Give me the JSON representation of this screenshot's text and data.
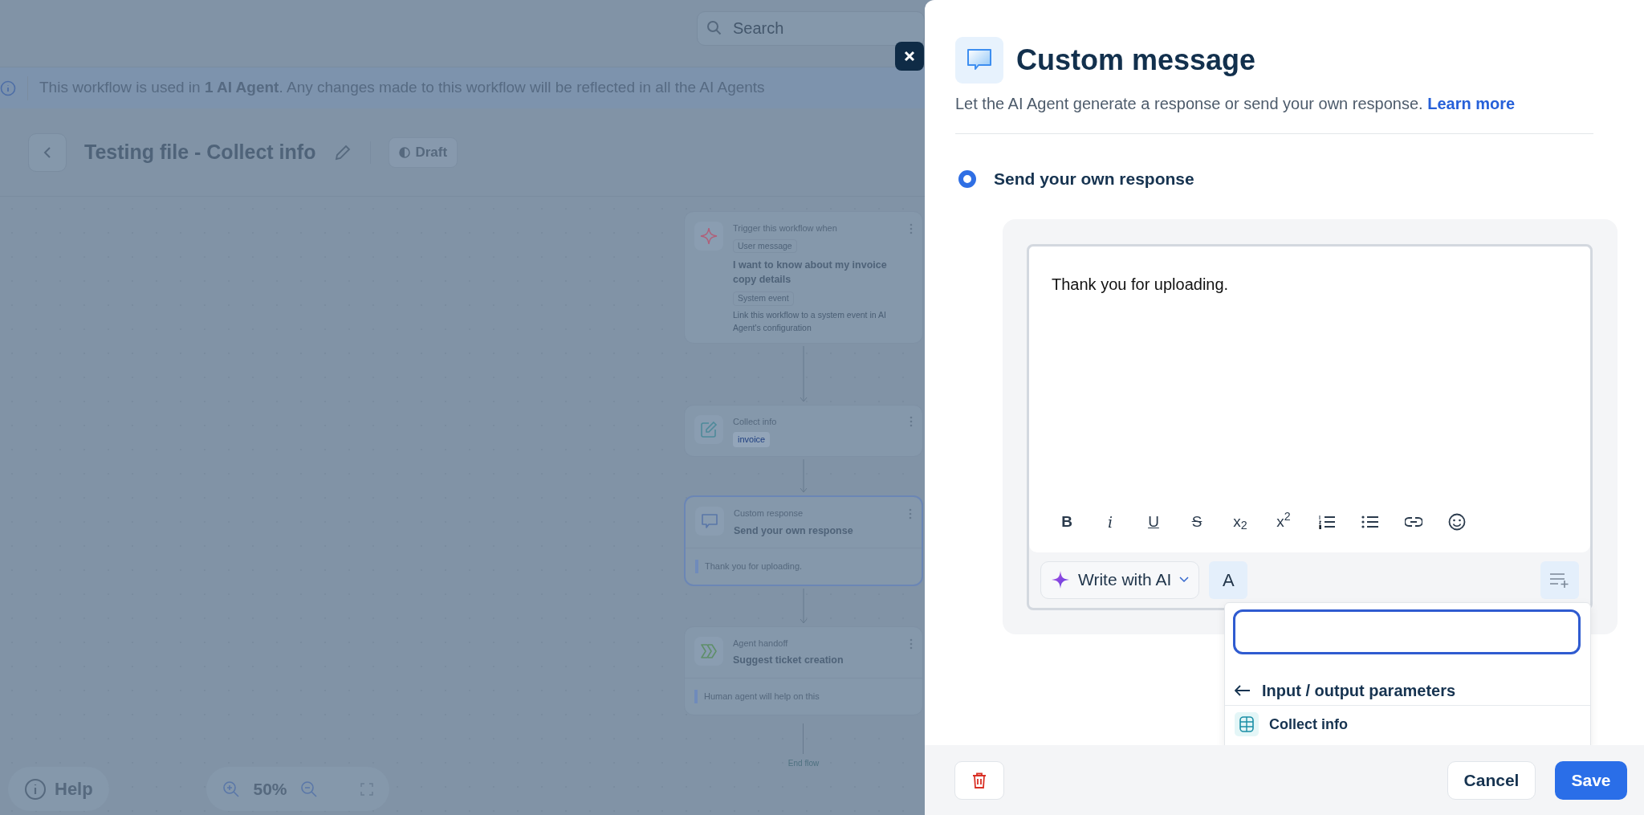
{
  "search": {
    "placeholder": "Search"
  },
  "banner": {
    "text": "This workflow is used in **1 AI Agent**. Any changes made to this workflow will be reflected in all the AI Agents"
  },
  "header": {
    "title": "Testing file - Collect info",
    "status": "Draft"
  },
  "flow": {
    "nodes": [
      {
        "kind": "trigger",
        "label": "Trigger this workflow when",
        "selected": false,
        "sections": [
          {
            "tag": "User message",
            "text": "I want to know about my invoice copy details"
          },
          {
            "tag": "System event",
            "hint": "Link this workflow to a system event in AI Agent's configuration"
          }
        ]
      },
      {
        "kind": "collect",
        "label": "Collect info",
        "selected": false,
        "chip": "invoice"
      },
      {
        "kind": "response",
        "label": "Custom response",
        "selected": true,
        "title": "Send your own response",
        "quote": "Thank you for uploading."
      },
      {
        "kind": "handoff",
        "label": "Agent handoff",
        "selected": false,
        "title": "Suggest ticket creation",
        "quote": "Human agent will help on this"
      }
    ],
    "end": "End flow"
  },
  "help": "Help",
  "zoom": {
    "value": "50%"
  },
  "panel": {
    "title": "Custom message",
    "subtitle": "Let the AI Agent generate a response or send your own response.",
    "learn_more": "Learn more",
    "option": {
      "label": "Send your own response",
      "selected": true
    },
    "editor": {
      "text": "Thank you for uploading.",
      "toolbar": [
        {
          "kind": "bold",
          "glyph": "B"
        },
        {
          "kind": "italic",
          "glyph": "i"
        },
        {
          "kind": "underline",
          "glyph": "U"
        },
        {
          "kind": "strikethrough",
          "glyph": "S"
        },
        {
          "kind": "subscript",
          "glyph": "x$_{2}$"
        },
        {
          "kind": "superscript",
          "glyph": "x$^{2}$"
        },
        {
          "kind": "numbered-list"
        },
        {
          "kind": "bulleted-list"
        },
        {
          "kind": "link"
        },
        {
          "kind": "emoji"
        }
      ],
      "ai_button": "Write with AI",
      "font_button": "A"
    },
    "dropdown": {
      "back_label": "Input / output parameters",
      "items": [
        {
          "label": "Collect info"
        }
      ]
    },
    "cancel": "Cancel",
    "save": "Save"
  }
}
